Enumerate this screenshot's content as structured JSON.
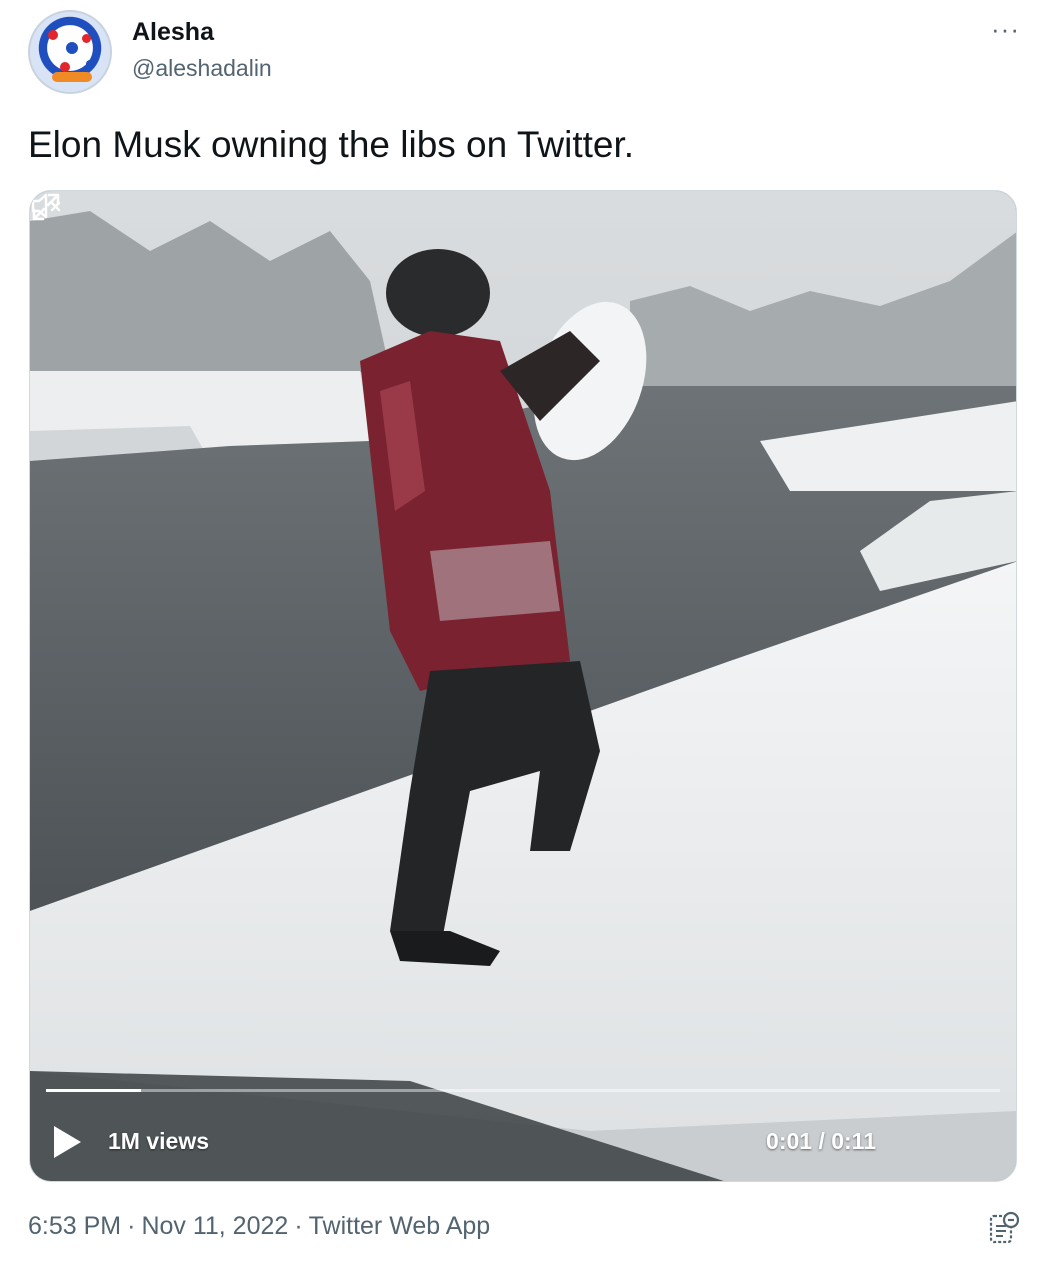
{
  "author": {
    "name": "Alesha",
    "handle": "@aleshadalin"
  },
  "tweet": {
    "text": "Elon Musk owning the libs on Twitter."
  },
  "video": {
    "views": "1M views",
    "time": "0:01 / 0:11",
    "progress": 0.1,
    "play_icon": "play-icon",
    "mute_icon": "muted-speaker-icon",
    "expand_icon": "expand-icon"
  },
  "footer": {
    "time": "6:53 PM",
    "date": "Nov 11, 2022",
    "source": "Twitter Web App",
    "separator": "·"
  },
  "colors": {
    "secondary_text": "#536471",
    "primary_text": "#0f1419"
  }
}
